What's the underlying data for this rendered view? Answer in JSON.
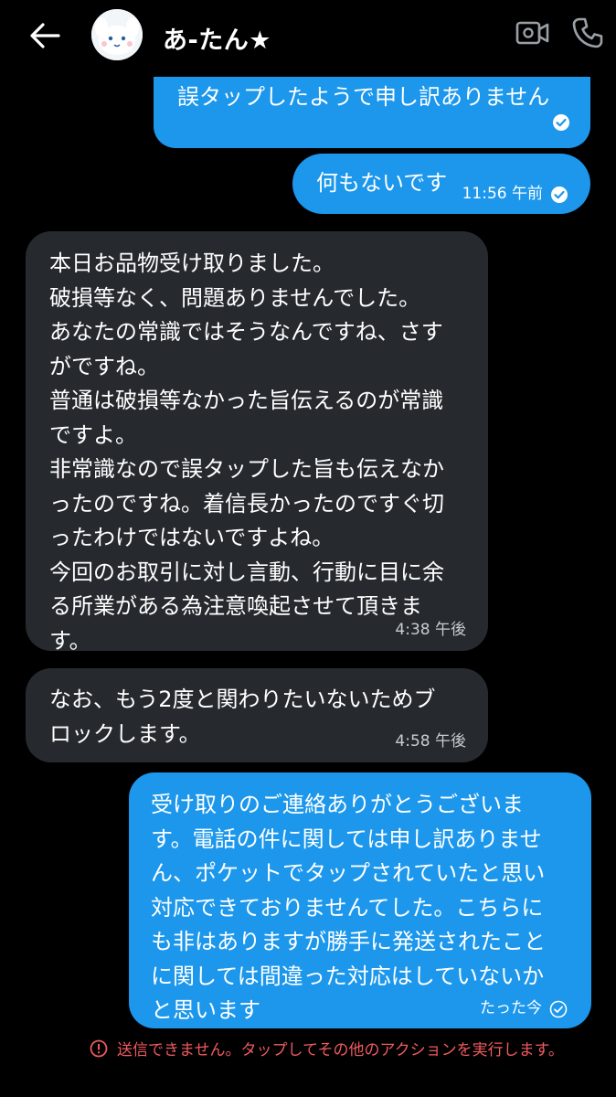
{
  "header": {
    "contact_name": "あ-たん★",
    "icons": {
      "back": "back-arrow-icon",
      "avatar": "avatar-image",
      "video": "video-call-icon",
      "call": "phone-call-icon"
    }
  },
  "colors": {
    "outgoing_bubble": "#1c97ec",
    "incoming_bubble": "#262a2f",
    "error": "#f05a5f",
    "background": "#000000"
  },
  "messages": [
    {
      "direction": "out",
      "text": "誤タップしたようで申し訳ありません",
      "time": "",
      "status": "read"
    },
    {
      "direction": "out",
      "text": "何もないです",
      "time": "11:56 午前",
      "status": "read"
    },
    {
      "direction": "in",
      "text": "本日お品物受け取りました。\n破損等なく、問題ありませんでした。\nあなたの常識ではそうなんですね、さす\nがですね。\n普通は破損等なかった旨伝えるのが常識\nですよ。\n非常識なので誤タップした旨も伝えなか\nったのですね。着信長かったのですぐ切\nったわけではないですよね。\n今回のお取引に対し言動、行動に目に余\nる所業がある為注意喚起させて頂きま\nす。",
      "time": "4:38 午後"
    },
    {
      "direction": "in",
      "text": "なお、もう2度と関わりたいないためブ\nロックします。",
      "time": "4:58 午後"
    },
    {
      "direction": "out",
      "text": "受け取りのご連絡ありがとうございま\nす。電話の件に関しては申し訳ありませ\nん、ポケットでタップされていたと思い\n対応できておりませんてした。こちらに\nも非はありますが勝手に発送されたこと\nに関しては間違った対応はしていないか\nと思います",
      "time": "たった今",
      "status": "sent"
    }
  ],
  "error": {
    "text": "送信できません。タップしてその他のアクションを実行します。",
    "icon": "alert-circle-icon"
  }
}
